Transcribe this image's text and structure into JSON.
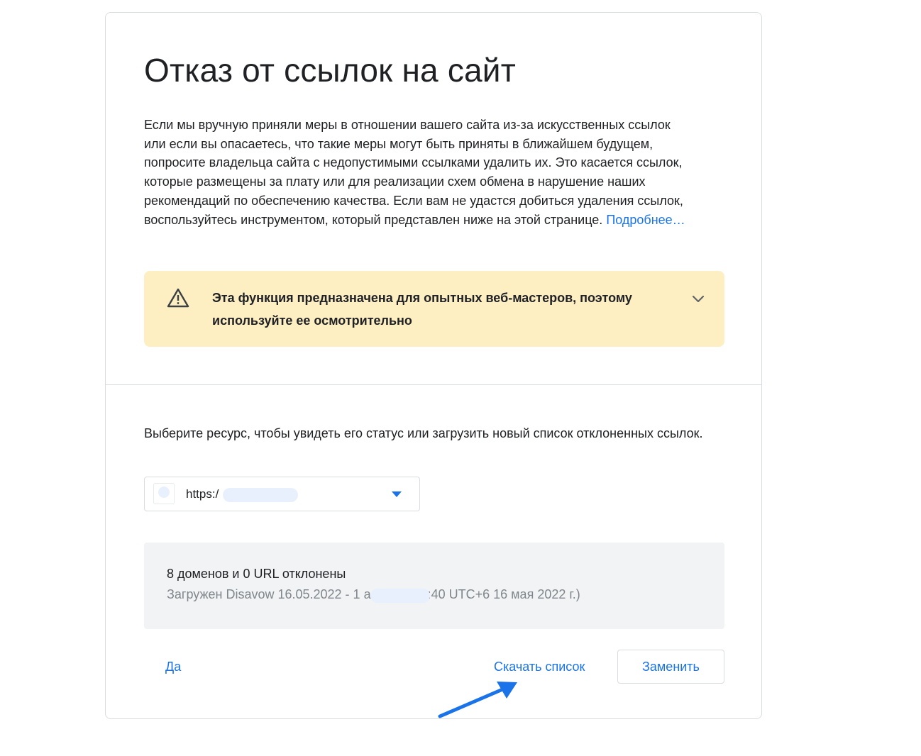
{
  "title": "Отказ от ссылок на сайт",
  "intro": {
    "text": "Если мы вручную приняли меры в отношении вашего сайта из-за искусственных ссылок или если вы опасаетесь, что такие меры могут быть приняты в ближайшем будущем, попросите владельца сайта с недопустимыми ссылками удалить их. Это касается ссылок, которые размещены за плату или для реализации схем обмена в нарушение наших рекомендаций по обеспечению качества. Если вам не удастся добиться удаления ссылок, воспользуйтесь инструментом, который представлен ниже на этой странице.",
    "link": "Подробнее…"
  },
  "warning": {
    "icon": "warning-triangle-icon",
    "text": "Эта функция предназначена для опытных веб-мастеров, поэтому используйте ее осмотрительно",
    "expand_icon": "chevron-down-icon",
    "background": "#feefc3"
  },
  "property": {
    "prompt": "Выберите ресурс, чтобы увидеть его статус или загрузить новый список отклоненных ссылок.",
    "selected_value": "https:/",
    "dropdown_icon": "caret-down-icon"
  },
  "status": {
    "title": "8 доменов и 0 URL отклонены",
    "detail": "Загружен Disavow 16.05.2022 - 1                  a.txt (18:28:40 UTC+6 16 мая 2022 г.)"
  },
  "actions": {
    "yes_label": "Да",
    "download_label": "Скачать список",
    "replace_label": "Заменить"
  },
  "colors": {
    "accent": "#1a73e8",
    "annotation_arrow": "#1a73e8"
  }
}
